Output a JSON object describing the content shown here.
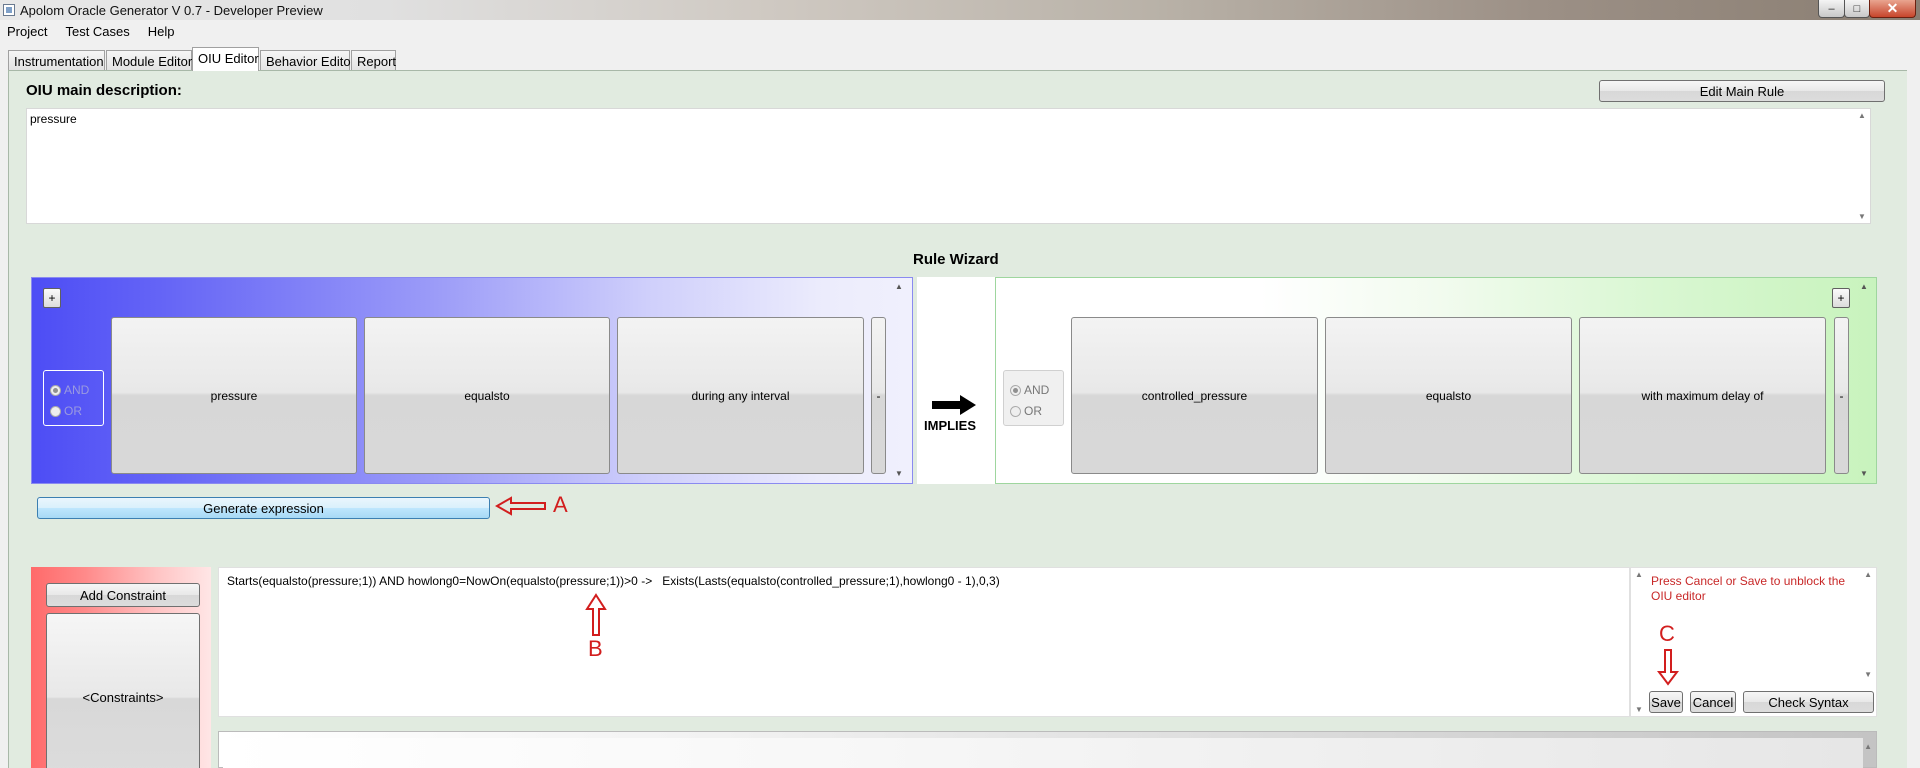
{
  "window": {
    "title": "Apolom Oracle Generator V 0.7 - Developer Preview",
    "minimize": "–",
    "maximize": "□",
    "close": "✕"
  },
  "menu": [
    "Project",
    "Test Cases",
    "Help"
  ],
  "tabs": [
    {
      "label": "Instrumentation",
      "active": false
    },
    {
      "label": "Module Editor",
      "active": false
    },
    {
      "label": "OIU Editor",
      "active": true
    },
    {
      "label": "Behavior Editor",
      "active": false
    },
    {
      "label": "Report",
      "active": false
    }
  ],
  "oiu": {
    "main_description_label": "OIU main description:",
    "edit_main_rule": "Edit Main Rule",
    "description_text": "pressure"
  },
  "wizard": {
    "title": "Rule Wizard",
    "lhs": {
      "plus": "+",
      "and_label": "AND",
      "or_label": "OR",
      "selected": "AND",
      "buttons": [
        "pressure",
        "equalsto",
        "during any interval"
      ],
      "dash": "-"
    },
    "implies_label": "IMPLIES",
    "rhs": {
      "plus": "+",
      "and_label": "AND",
      "or_label": "OR",
      "selected": "AND",
      "buttons": [
        "controlled_pressure",
        "equalsto",
        "with maximum delay of"
      ],
      "dash": "-"
    }
  },
  "generate_expression": "Generate expression",
  "annotations": {
    "a": "A",
    "b": "B",
    "c": "C"
  },
  "constraints": {
    "add_button": "Add Constraint",
    "list_button": "<Constraints>"
  },
  "expression": "Starts(equalsto(pressure;1)) AND howlong0=NowOn(equalsto(pressure;1))>0 ->   Exists(Lasts(equalsto(controlled_pressure;1),howlong0 - 1),0,3)",
  "message": "Press Cancel or Save to unblock the OIU editor",
  "actions": {
    "save": "Save",
    "cancel": "Cancel",
    "check_syntax": "Check Syntax"
  },
  "colors": {
    "annotation": "#d21e1e",
    "message": "#c82828",
    "lhs_panel": "#4d4df5",
    "rhs_panel": "#c8f3bd",
    "constraint_panel": "#ff6a6a"
  }
}
